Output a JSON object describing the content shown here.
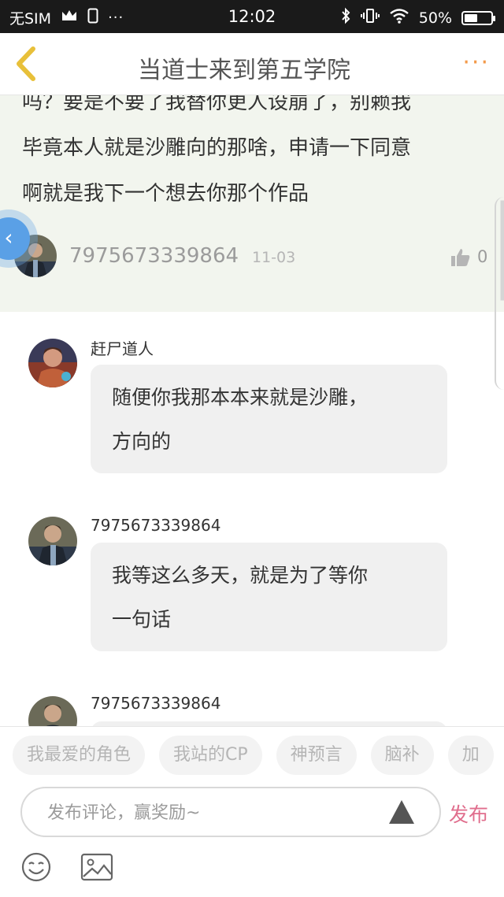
{
  "status_bar": {
    "carrier": "无SIM",
    "time": "12:02",
    "battery_label": "50%",
    "battery_level": 0.5,
    "icons": [
      "crown-icon",
      "phone-icon",
      "more-dots-icon",
      "bluetooth-icon",
      "vibrate-icon",
      "wifi-icon",
      "battery-icon"
    ]
  },
  "header": {
    "title": "当道士来到第五学院",
    "more_label": "···",
    "accent_color": "#f39a4a",
    "back_color": "#e8c03a"
  },
  "post": {
    "lines": [
      "吗？要是不要了我替你更人设崩了，别赖我",
      "毕竟本人就是沙雕向的那啥，申请一下同意",
      "啊就是我下一个想去你那个作品"
    ],
    "username": "7975673339864",
    "date": "11-03",
    "like_count": "0",
    "background_color": "#f2f5ee"
  },
  "replies": [
    {
      "username": "赶尸道人",
      "lines": [
        "随便你我那本本来就是沙雕，",
        "方向的"
      ]
    },
    {
      "username": "7975673339864",
      "lines": [
        "我等这么多天，就是为了等你",
        "一句话"
      ]
    },
    {
      "username": "7975673339864",
      "lines": []
    }
  ],
  "tags": [
    "我最爱的角色",
    "我站的CP",
    "神预言",
    "脑补",
    "加"
  ],
  "composer": {
    "placeholder": "发布评论，赢奖励~",
    "publish_label": "发布",
    "publish_color": "#e06e8d"
  }
}
